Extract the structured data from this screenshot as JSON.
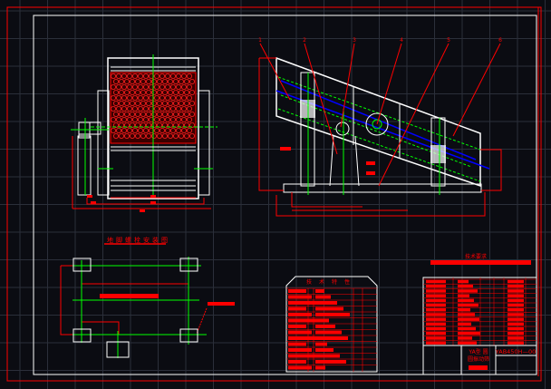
{
  "colors": {
    "background": "#0b0c12",
    "grid": "#2b2f3a",
    "frame": "#ffffff",
    "annotation": "#ff0000",
    "centerline": "#00ff00",
    "screen_deck": "#0000ff"
  },
  "drawing": {
    "foundation_title": "地脚螺栓安装图",
    "tech_spec_title": "技术特性",
    "tech_req_title": "技术要求",
    "part_numbers": [
      "1",
      "2",
      "3",
      "4",
      "5",
      "6"
    ],
    "title_block": {
      "product_name_line1": "YA型 圆",
      "product_name_line2": "圆振动筛",
      "drawing_number": "YAB450H—00"
    }
  }
}
